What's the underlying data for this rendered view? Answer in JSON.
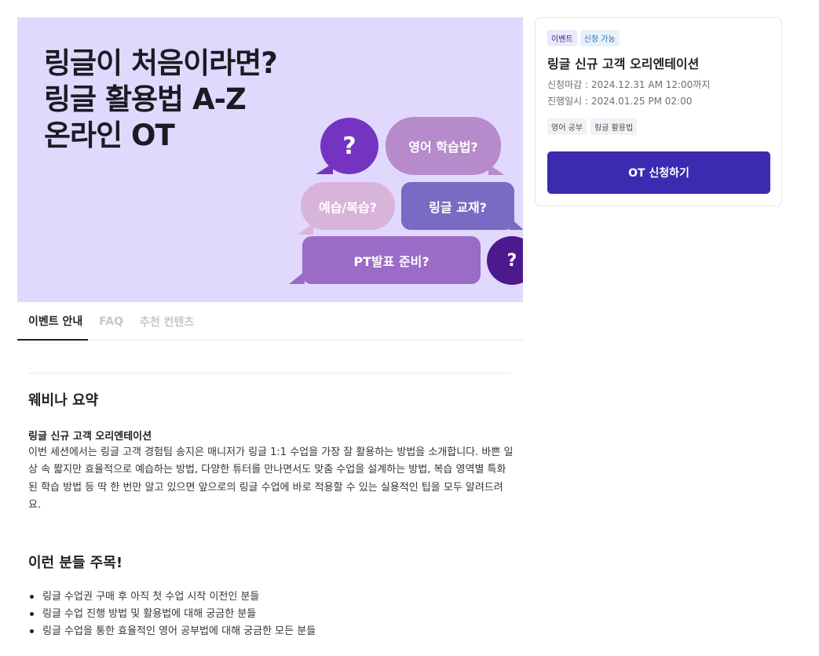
{
  "banner": {
    "title_lines": [
      "링글이 처음이라면?",
      "링글 활용법 A-Z",
      "온라인 OT"
    ],
    "bubbles": {
      "q1": "?",
      "study": "영어 학습법?",
      "prep": "예습/복습?",
      "book": "링글 교재?",
      "pt": "PT발표 준비?",
      "q2": "?"
    }
  },
  "tabs": [
    {
      "label": "이벤트 안내",
      "active": true
    },
    {
      "label": "FAQ",
      "active": false
    },
    {
      "label": "추천 컨텐츠",
      "active": false
    }
  ],
  "summary": {
    "heading": "웨비나 요약",
    "subtitle": "링글 신규 고객 오리엔테이션",
    "body": "이번 세션에서는 링글 고객 경험팀 송지은 매니저가 링글 1:1 수업을 가장 잘 활용하는 방법을 소개합니다. 바쁜 일상 속 짧지만 효율적으로 예습하는 방법, 다양한 튜터를 만나면서도 맞춤 수업을 설계하는 방법, 복습 영역별 특화된 학습 방법 등 딱 한 번만 알고 있으면 앞으로의 링글 수업에 바로 적용할 수 있는 실용적인 팁을 모두 알려드려요."
  },
  "audience": {
    "heading": "이런 분들 주목!",
    "items": [
      "링글 수업권 구매 후 아직 첫 수업 시작 이전인 분들",
      "링글 수업 진행 방법 및 활용법에 대해 궁금한 분들",
      "링글 수업을 통한 효율적인 영어 공부법에 대해 궁금한 모든 분들"
    ]
  },
  "card": {
    "badges": {
      "event": "이벤트",
      "open": "신청 가능"
    },
    "title": "링글 신규 고객 오리엔테이션",
    "deadline": "신청마감 : 2024.12.31 AM 12:00까지",
    "schedule": "진행일시 : 2024.01.25 PM 02:00",
    "tags": [
      "영어 공부",
      "링글 활용법"
    ],
    "apply_label": "OT 신청하기"
  }
}
